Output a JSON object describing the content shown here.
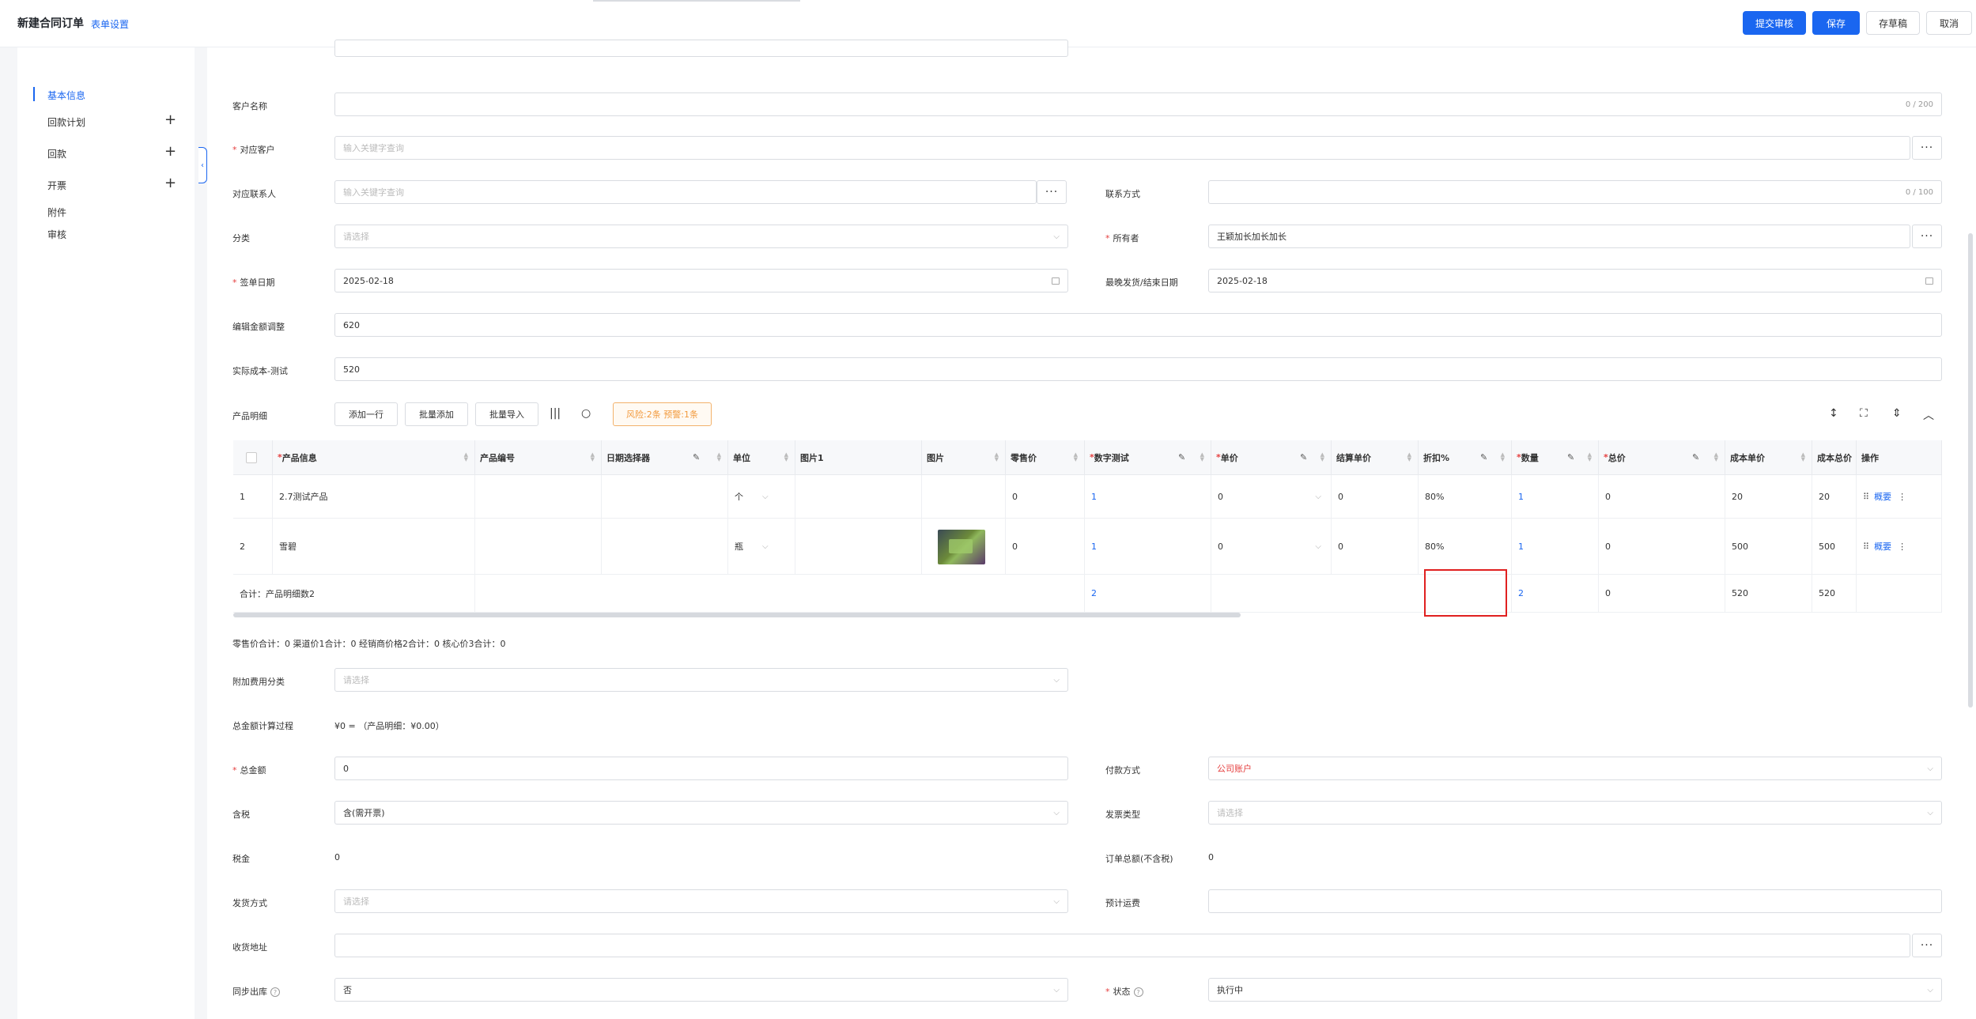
{
  "header": {
    "title": "新建合同订单",
    "form_settings": "表单设置",
    "buttons": {
      "submit": "提交审核",
      "save": "保存",
      "draft": "存草稿",
      "cancel": "取消"
    }
  },
  "sidebar": {
    "items": [
      {
        "label": "基本信息",
        "active": true
      },
      {
        "label": "回款计划"
      },
      {
        "label": "回款"
      },
      {
        "label": "开票"
      },
      {
        "label": "附件"
      },
      {
        "label": "审核"
      }
    ]
  },
  "form": {
    "customer_name": {
      "label": "客户名称",
      "counter": "0 / 200"
    },
    "related_customer": {
      "label": "对应客户",
      "placeholder": "输入关键字查询"
    },
    "related_contact": {
      "label": "对应联系人",
      "placeholder": "输入关键字查询"
    },
    "contact_method": {
      "label": "联系方式",
      "counter": "0 / 100"
    },
    "category": {
      "label": "分类",
      "placeholder": "请选择"
    },
    "owner": {
      "label": "所有者",
      "value": "王颖加长加长加长"
    },
    "sign_date": {
      "label": "签单日期",
      "value": "2025-02-18"
    },
    "latest_delivery": {
      "label": "最晚发货/结束日期",
      "value": "2025-02-18"
    },
    "amount_adjust": {
      "label": "编辑金额调整",
      "value": "620"
    },
    "actual_cost": {
      "label": "实际成本-测试",
      "value": "520"
    },
    "product_detail": {
      "label": "产品明细"
    },
    "extra_fee_category": {
      "label": "附加费用分类",
      "placeholder": "请选择"
    },
    "total_calc": {
      "label": "总金额计算过程",
      "value": "¥0 = （产品明细：¥0.00）"
    },
    "total_amount": {
      "label": "总金额",
      "value": "0"
    },
    "payment_method": {
      "label": "付款方式",
      "value": "公司账户"
    },
    "tax_included": {
      "label": "含税",
      "value": "含(需开票)"
    },
    "invoice_type": {
      "label": "发票类型",
      "placeholder": "请选择"
    },
    "tax": {
      "label": "税金",
      "value": "0"
    },
    "order_total_ex_tax": {
      "label": "订单总额(不含税)",
      "value": "0"
    },
    "shipping_method": {
      "label": "发货方式",
      "placeholder": "请选择"
    },
    "estimated_freight": {
      "label": "预计运费"
    },
    "shipping_address": {
      "label": "收货地址"
    },
    "sync_outbound": {
      "label": "同步出库",
      "value": "否"
    },
    "status": {
      "label": "状态",
      "value": "执行中"
    }
  },
  "toolbar": {
    "add_row": "添加一行",
    "batch_add": "批量添加",
    "batch_import": "批量导入",
    "risk": "风险:2条 预警:1条"
  },
  "table": {
    "headers": {
      "product_info": "产品信息",
      "product_code": "产品编号",
      "date_picker": "日期选择器",
      "unit": "单位",
      "image1": "图片1",
      "image": "图片",
      "retail_price": "零售价",
      "num_test": "数字测试",
      "unit_price": "单价",
      "settle_price": "结算单价",
      "discount": "折扣%",
      "quantity": "数量",
      "total_price": "总价",
      "cost_unit": "成本单价",
      "cost_total": "成本总价",
      "action": "操作"
    },
    "rows": [
      {
        "idx": "1",
        "name": "2.7测试产品",
        "unit": "个",
        "retail": "0",
        "num_test": "1",
        "unit_price": "0",
        "settle": "0",
        "discount": "80%",
        "qty": "1",
        "total": "0",
        "cost_unit": "20",
        "cost_total": "20",
        "action": "概要"
      },
      {
        "idx": "2",
        "name": "雪碧",
        "unit": "瓶",
        "retail": "0",
        "num_test": "1",
        "unit_price": "0",
        "settle": "0",
        "discount": "80%",
        "qty": "1",
        "total": "0",
        "cost_unit": "500",
        "cost_total": "500",
        "action": "概要"
      }
    ],
    "summary": {
      "label": "合计：产品明细数2",
      "num_test": "2",
      "qty": "2",
      "total": "0",
      "cost_unit": "520",
      "cost_total": "520"
    }
  },
  "totals_line": "零售价合计：0 渠道价1合计：0 经销商价格2合计：0 核心价3合计：0"
}
